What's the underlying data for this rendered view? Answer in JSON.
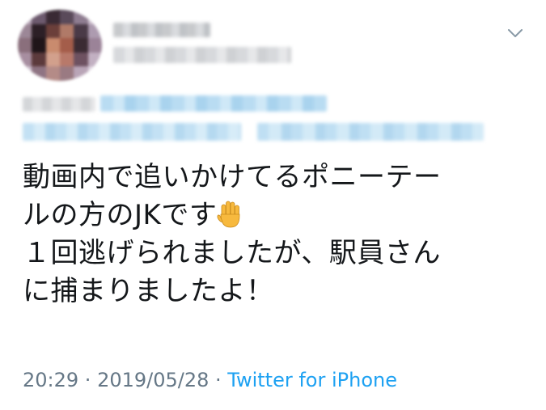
{
  "tweet": {
    "text_line1": "動画内で追いかけてるポニーテー",
    "text_line2": "ルの方のJKです",
    "text_line3": "１回逃げられましたが、駅員さん",
    "text_line4": "に捕まりましたよ！",
    "time": "20:29",
    "separator": " · ",
    "date": "2019/05/28",
    "separator2": " · ",
    "source": "Twitter for iPhone"
  },
  "icons": {
    "caret": "chevron-down-icon",
    "emoji": "raised-hand-icon"
  },
  "colors": {
    "text": "#14171a",
    "meta": "#657786",
    "link": "#1da1f2"
  }
}
